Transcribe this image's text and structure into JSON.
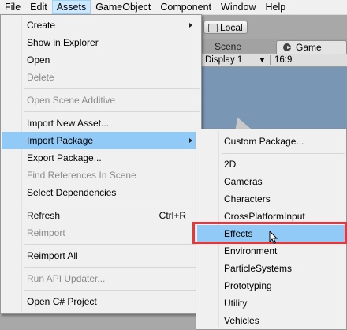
{
  "menubar": {
    "items": [
      "File",
      "Edit",
      "Assets",
      "GameObject",
      "Component",
      "Window",
      "Help"
    ]
  },
  "editor": {
    "local_button": "Local",
    "tabs": [
      "Scene",
      "Game"
    ],
    "game_toolbar": {
      "display": "Display 1",
      "aspect": "16:9"
    }
  },
  "assets_menu": {
    "items": [
      {
        "label": "Create",
        "submenu": true,
        "disabled": false
      },
      {
        "label": "Show in Explorer",
        "disabled": false
      },
      {
        "label": "Open",
        "disabled": false
      },
      {
        "label": "Delete",
        "disabled": true
      },
      {
        "label": "Open Scene Additive",
        "disabled": true
      },
      {
        "label": "Import New Asset...",
        "disabled": false
      },
      {
        "label": "Import Package",
        "submenu": true,
        "disabled": false,
        "highlighted": true
      },
      {
        "label": "Export Package...",
        "disabled": false
      },
      {
        "label": "Find References In Scene",
        "disabled": true
      },
      {
        "label": "Select Dependencies",
        "disabled": false
      },
      {
        "label": "Refresh",
        "shortcut": "Ctrl+R",
        "disabled": false
      },
      {
        "label": "Reimport",
        "disabled": true
      },
      {
        "label": "Reimport All",
        "disabled": false
      },
      {
        "label": "Run API Updater...",
        "disabled": true
      },
      {
        "label": "Open C# Project",
        "disabled": false
      }
    ]
  },
  "import_package_submenu": {
    "items": [
      {
        "label": "Custom Package..."
      },
      {
        "label": "2D"
      },
      {
        "label": "Cameras"
      },
      {
        "label": "Characters"
      },
      {
        "label": "CrossPlatformInput"
      },
      {
        "label": "Effects",
        "highlighted": true
      },
      {
        "label": "Environment"
      },
      {
        "label": "ParticleSystems"
      },
      {
        "label": "Prototyping"
      },
      {
        "label": "Utility"
      },
      {
        "label": "Vehicles"
      }
    ]
  },
  "colors": {
    "highlight": "#91c9f7",
    "annotation_box": "#e8373c",
    "game_view_sky": "#7a96b5"
  }
}
